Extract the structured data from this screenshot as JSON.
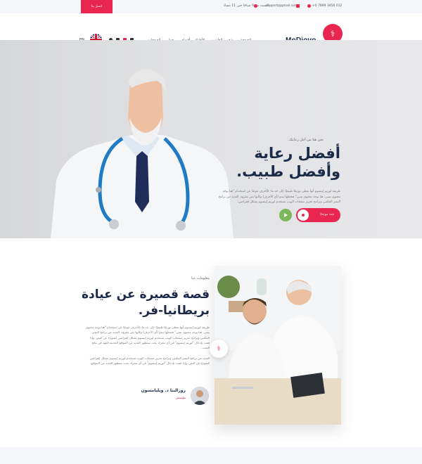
{
  "topbar": {
    "cta_label": "اتصل بنا",
    "phone": "+0 7899 3456 012",
    "email": "support@gmail.com",
    "hours": "السبت من 9 صباحًا حتى 11 مساءً"
  },
  "navbar": {
    "logo_text": "MoDiovo",
    "logo_mark": "⚕",
    "items": [
      "الصفحة",
      "متجر",
      "الطبيب",
      "الأطباء",
      "أقسام",
      "حول",
      "الصفحات"
    ],
    "language": "EN"
  },
  "hero": {
    "kicker": "نحن هنا من أجل رعايتك.",
    "title_line1": "أفضل رعاية",
    "title_line2": "وأفضل طبيب.",
    "text": "طريقة لوريم إيبسوم أنها تعطي توزيعًا طبيعيًا -إلى حد ما- للأحرف عوضًا عن استخدام \"هنا يوجد محتوى نصي، هنا يوجد محتوى نصي\" فتجعلها تبدو (أي الأحرف) وكأنها نص مقروء. العديد من برامح النشر المكتبي وبرامح تحرير صفحات الويب تستخدم لوريم إيبسوم بشكل إفتراضي.",
    "button_label": "حدد موعدًا"
  },
  "about": {
    "kicker": "معلومات عنا",
    "title_line1": "قصة قصيرة عن عيادة",
    "title_line2": "بريطانيا-فر.",
    "para1": "طريقة لوريم إيبسوم أنها تعطي توزيعًا طبيعيًا -إلى حد ما- للأحرف عوضًا عن استخدام \"هنا يوجد محتوى نصي، هنا يوجد محتوى نصي\" فتجعلها تبدو (أي الأحرف) وكأنها نص مقروء. العديد من برامح النشر المكتبي وبرامح تحرير صفحات الويب تستخدم لوريم إيبسوم بشكل إفتراضي كنموذج عن النص، وإذا قمت بإدخال \"لوريم إيبسوم\" في أي محرك بحث ستظهر العديد من المواقع الحديثة العهد في نتائج البحث.",
    "para2": "العديد من برامح النشر المكتبي وبرامح تحرير صفحات الويب تستخدم لوريم إيبسوم بشكل إفتراضي كنموذج عن النص، وإذا قمت بإدخال \"لوريم إيبسوم\" في أي محرك بحث ستظهر العديد من المواقع.",
    "author_name": "روزالينا د. ويليامسون",
    "author_role": "مؤسس"
  },
  "colors": {
    "accent": "#e8264f",
    "navy": "#1c2a4a",
    "green": "#7ab85a"
  }
}
